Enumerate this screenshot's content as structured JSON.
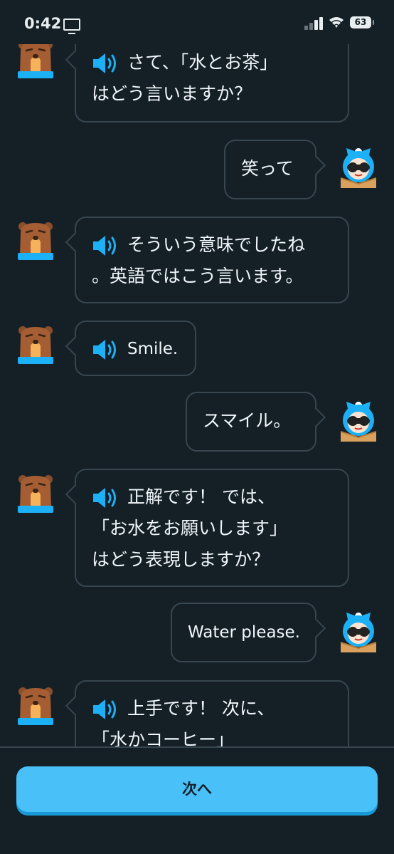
{
  "status_bar": {
    "time": "0:42",
    "battery": "63"
  },
  "messages": [
    {
      "id": "m1",
      "side": "left",
      "speaker": true,
      "lines": [
        "さて、「水とお茶」",
        "はどう言いますか？"
      ]
    },
    {
      "id": "m2",
      "side": "right",
      "speaker": false,
      "lines": [
        "笑って"
      ]
    },
    {
      "id": "m3",
      "side": "left",
      "speaker": true,
      "lines": [
        "そういう意味でしたね",
        "。英語ではこう言います。"
      ]
    },
    {
      "id": "m4",
      "side": "left",
      "speaker": true,
      "lines": [
        "Smile."
      ]
    },
    {
      "id": "m5",
      "side": "right",
      "speaker": false,
      "lines": [
        "スマイル。"
      ]
    },
    {
      "id": "m6",
      "side": "left",
      "speaker": true,
      "lines": [
        "正解です！ では、",
        "「お水をお願いします」",
        "はどう表現しますか？"
      ]
    },
    {
      "id": "m7",
      "side": "right",
      "speaker": false,
      "lines": [
        "Water please."
      ]
    },
    {
      "id": "m8",
      "side": "left",
      "speaker": true,
      "lines": [
        "上手です！ 次に、",
        "「水かコーヒー」"
      ]
    }
  ],
  "footer": {
    "next_label": "次へ"
  },
  "colors": {
    "background": "#141f26",
    "bubble_border": "#37464f",
    "accent": "#49c0f8",
    "speaker": "#1cb0f6"
  }
}
